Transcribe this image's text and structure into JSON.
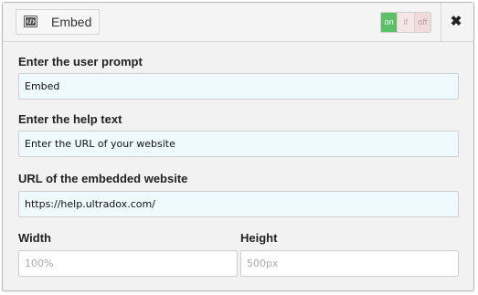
{
  "header": {
    "icon": "embed-code-icon",
    "title": "Embed",
    "toggle": {
      "on": "on",
      "if": "if",
      "off": "off",
      "active": "on"
    },
    "close_symbol": "✖"
  },
  "fields": {
    "prompt": {
      "label": "Enter the user prompt",
      "value": "Embed"
    },
    "help": {
      "label": "Enter the help text",
      "value": "Enter the URL of your website"
    },
    "url": {
      "label": "URL of the embedded website",
      "value": "https://help.ultradox.com/"
    },
    "width": {
      "label": "Width",
      "placeholder": "100%"
    },
    "height": {
      "label": "Height",
      "placeholder": "500px"
    }
  },
  "colors": {
    "on": "#5cc069",
    "field_bg": "#eefaff",
    "panel_bg": "#f2f2f2"
  }
}
